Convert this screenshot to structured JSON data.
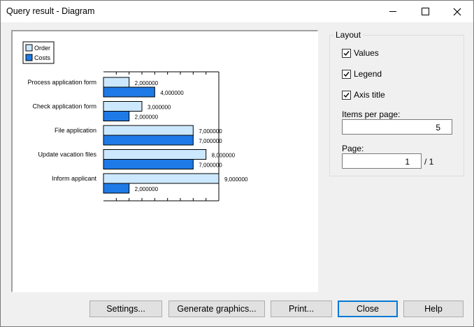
{
  "window": {
    "title": "Query result - Diagram"
  },
  "titlebar_icons": [
    "minimize-icon",
    "maximize-icon",
    "close-icon"
  ],
  "chart_data": {
    "type": "bar",
    "orientation": "horizontal",
    "categories": [
      "Process application form",
      "Check application form",
      "File application",
      "Update vacation files",
      "Inform applicant"
    ],
    "series": [
      {
        "name": "Order",
        "values": [
          2,
          3,
          7,
          8,
          9
        ],
        "labels": [
          "2,000000",
          "3,000000",
          "7,000000",
          "8,000000",
          "9,000000"
        ],
        "color": "#cce8ff"
      },
      {
        "name": "Costs",
        "values": [
          4,
          2,
          7,
          7,
          2
        ],
        "labels": [
          "4,000000",
          "2,000000",
          "7,000000",
          "7,000000",
          "2,000000"
        ],
        "color": "#1e7ae6"
      }
    ],
    "xlim": [
      0,
      9
    ],
    "grid": false,
    "legend": "top-left"
  },
  "layout_panel": {
    "legend": "Layout",
    "values_label": "Values",
    "legend_label": "Legend",
    "axis_title_label": "Axis title",
    "values_checked": true,
    "legend_checked": true,
    "axis_title_checked": true,
    "items_per_page_label": "Items per page:",
    "items_per_page_value": "5",
    "page_label": "Page:",
    "page_value": "1",
    "page_total": "/ 1"
  },
  "buttons": {
    "settings": "Settings...",
    "generate": "Generate graphics...",
    "print": "Print...",
    "close": "Close",
    "help": "Help"
  }
}
